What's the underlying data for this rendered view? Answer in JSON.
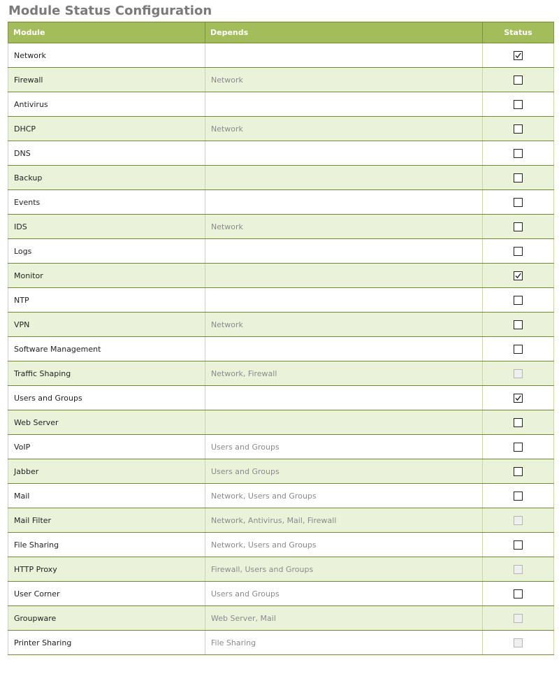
{
  "page": {
    "title": "Module Status Configuration"
  },
  "table": {
    "headers": {
      "module": "Module",
      "depends": "Depends",
      "status": "Status"
    },
    "rows": [
      {
        "module": "Network",
        "depends": "",
        "status": "checked"
      },
      {
        "module": "Firewall",
        "depends": "Network",
        "status": "unchecked"
      },
      {
        "module": "Antivirus",
        "depends": "",
        "status": "unchecked"
      },
      {
        "module": "DHCP",
        "depends": "Network",
        "status": "unchecked"
      },
      {
        "module": "DNS",
        "depends": "",
        "status": "unchecked"
      },
      {
        "module": "Backup",
        "depends": "",
        "status": "unchecked"
      },
      {
        "module": "Events",
        "depends": "",
        "status": "unchecked"
      },
      {
        "module": "IDS",
        "depends": "Network",
        "status": "unchecked"
      },
      {
        "module": "Logs",
        "depends": "",
        "status": "unchecked"
      },
      {
        "module": "Monitor",
        "depends": "",
        "status": "checked"
      },
      {
        "module": "NTP",
        "depends": "",
        "status": "unchecked"
      },
      {
        "module": "VPN",
        "depends": "Network",
        "status": "unchecked"
      },
      {
        "module": "Software Management",
        "depends": "",
        "status": "unchecked"
      },
      {
        "module": "Traffic Shaping",
        "depends": "Network, Firewall",
        "status": "disabled"
      },
      {
        "module": "Users and Groups",
        "depends": "",
        "status": "checked"
      },
      {
        "module": "Web Server",
        "depends": "",
        "status": "unchecked"
      },
      {
        "module": "VoIP",
        "depends": "Users and Groups",
        "status": "unchecked"
      },
      {
        "module": "Jabber",
        "depends": "Users and Groups",
        "status": "unchecked"
      },
      {
        "module": "Mail",
        "depends": "Network, Users and Groups",
        "status": "unchecked"
      },
      {
        "module": "Mail Filter",
        "depends": "Network, Antivirus, Mail, Firewall",
        "status": "disabled"
      },
      {
        "module": "File Sharing",
        "depends": "Network, Users and Groups",
        "status": "unchecked"
      },
      {
        "module": "HTTP Proxy",
        "depends": "Firewall, Users and Groups",
        "status": "disabled"
      },
      {
        "module": "User Corner",
        "depends": "Users and Groups",
        "status": "unchecked"
      },
      {
        "module": "Groupware",
        "depends": "Web Server, Mail",
        "status": "disabled"
      },
      {
        "module": "Printer Sharing",
        "depends": "File Sharing",
        "status": "disabled"
      }
    ]
  },
  "colors": {
    "header_bg": "#a3bd5a",
    "row_alt_bg": "#eaf3da",
    "title": "#7a7a7a"
  }
}
